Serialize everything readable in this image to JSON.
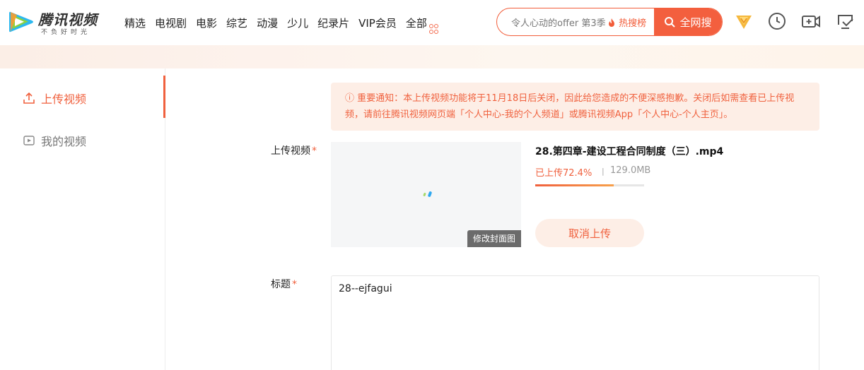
{
  "header": {
    "logo_name": "腾讯视频",
    "logo_slogan": "不负好时光",
    "nav": [
      "精选",
      "电视剧",
      "电影",
      "综艺",
      "动漫",
      "少儿",
      "纪录片",
      "VIP会员",
      "全部"
    ],
    "search_placeholder": "令人心动的offer 第3季",
    "hot_label": "热搜榜",
    "search_button": "全网搜",
    "icons": [
      "vip-icon",
      "history-icon",
      "upload-video-icon",
      "cast-icon"
    ],
    "accent": "#f35f3e"
  },
  "sidebar": {
    "items": [
      {
        "label": "上传视频",
        "icon": "upload-icon",
        "active": true
      },
      {
        "label": "我的视频",
        "icon": "my-video-icon",
        "active": false
      }
    ]
  },
  "notice": {
    "text": "ⓘ 重要通知：本上传视频功能将于11月18日后关闭，因此给您造成的不便深感抱歉。关闭后如需查看已上传视频，请前往腾讯视频网页端「个人中心-我的个人频道」或腾讯视频App「个人中心-个人主页」。"
  },
  "upload": {
    "label": "上传视频",
    "required_mark": "*",
    "cover_button": "修改封面图",
    "file_name": "28.第四章-建设工程合同制度（三）.mp4",
    "progress_text": "已上传72.4%",
    "separator": "|",
    "progress_fraction": 0.724,
    "size_text": "129.0MB",
    "cancel_button": "取消上传"
  },
  "title_field": {
    "label": "标题",
    "required_mark": "*",
    "value": "28--ejfagui"
  }
}
